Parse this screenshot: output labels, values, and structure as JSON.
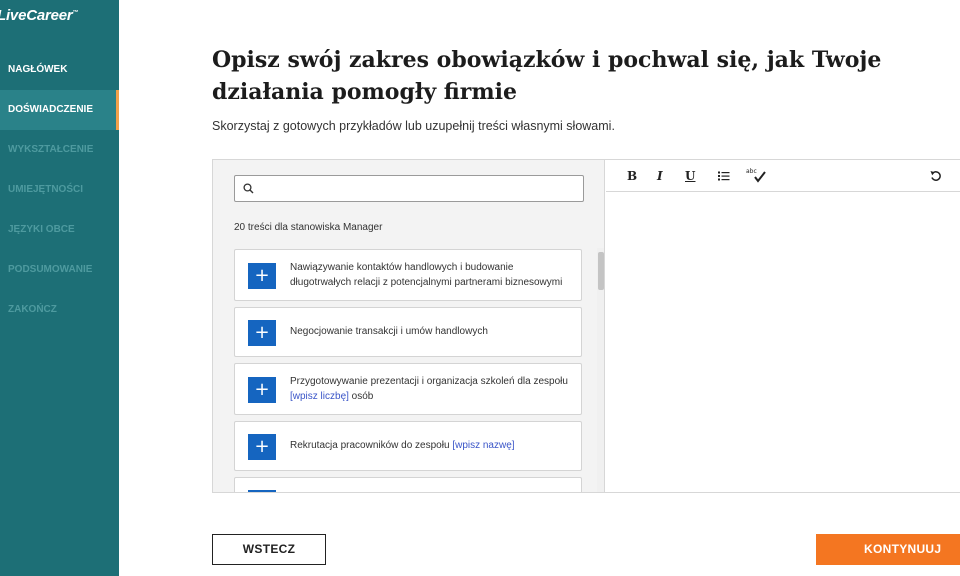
{
  "brand": {
    "logo_text": "LiveCareer",
    "trademark": "™"
  },
  "sidebar": {
    "items": [
      {
        "label": "NAGŁÓWEK",
        "state": "done"
      },
      {
        "label": "DOŚWIADCZENIE",
        "state": "active"
      },
      {
        "label": "WYKSZTAŁCENIE",
        "state": "inactive"
      },
      {
        "label": "UMIEJĘTNOŚCI",
        "state": "inactive"
      },
      {
        "label": "JĘZYKI OBCE",
        "state": "inactive"
      },
      {
        "label": "PODSUMOWANIE",
        "state": "inactive"
      },
      {
        "label": "ZAKOŃCZ",
        "state": "inactive"
      }
    ]
  },
  "main": {
    "title": "Opisz swój zakres obowiązków i pochwal się, jak Twoje działania pomogły firmie",
    "subtitle": "Skorzystaj z gotowych przykładów lub uzupełnij treści własnymi słowami."
  },
  "search": {
    "placeholder": "",
    "value": ""
  },
  "examples": {
    "count_label": "20 treści dla stanowiska Manager",
    "items": [
      {
        "text": "Nawiązywanie kontaktów handlowych i budowanie długotrwałych relacji z potencjalnymi partnerami biznesowymi",
        "placeholder": "",
        "suffix": ""
      },
      {
        "text": "Negocjowanie transakcji i umów handlowych",
        "placeholder": "",
        "suffix": ""
      },
      {
        "text": "Przygotowywanie prezentacji i organizacja szkoleń dla zespołu ",
        "placeholder": "[wpisz liczbę]",
        "suffix": " osób"
      },
      {
        "text": "Rekrutacja pracowników do zespołu ",
        "placeholder": "[wpisz nazwę]",
        "suffix": ""
      },
      {
        "text": "",
        "placeholder": "",
        "suffix": ""
      }
    ],
    "add_symbol": "+"
  },
  "editor": {
    "toolbar": {
      "bold": "B",
      "italic": "I",
      "underline": "U",
      "spell": "abc"
    },
    "content": ""
  },
  "footer": {
    "back_label": "WSTECZ",
    "continue_label": "KONTYNUUJ"
  },
  "colors": {
    "sidebar": "#1d6f76",
    "accent": "#f2a14b",
    "add_button": "#1565c0",
    "continue": "#f47621"
  }
}
